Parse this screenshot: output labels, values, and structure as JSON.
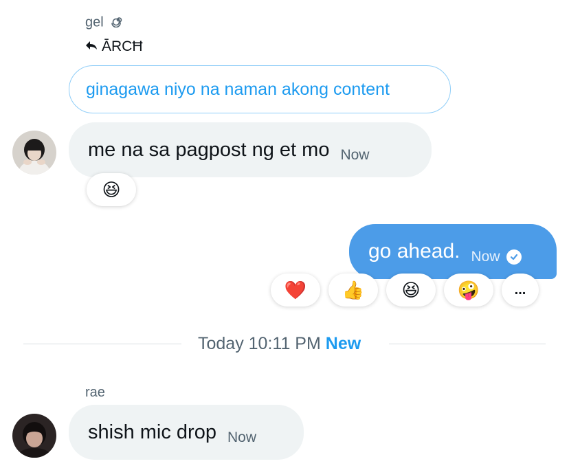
{
  "colors": {
    "accent": "#1d9bf0",
    "outgoing_bubble": "#4c9ce8",
    "incoming_bubble": "#eff3f4",
    "muted_text": "#536471"
  },
  "messages": [
    {
      "sender": "gel",
      "sender_badge_icon": "spiral-icon",
      "reply_icon": "reply-arrow-icon",
      "reply_to": "ĀRCĦ",
      "quoted_text": "ginagawa niyo na naman akong content",
      "text": "me na sa pagpost ng et mo",
      "time": "Now",
      "reaction": "😆"
    },
    {
      "direction": "outgoing",
      "text": "go ahead.",
      "time": "Now",
      "status_icon": "seen-check-icon",
      "reaction_bar": [
        "❤️",
        "👍",
        "😆",
        "🤪",
        "..."
      ]
    }
  ],
  "divider": {
    "label": "Today 10:11 PM",
    "new_label": "New"
  },
  "last_message": {
    "sender": "rae",
    "text": "shish mic drop",
    "time": "Now"
  }
}
